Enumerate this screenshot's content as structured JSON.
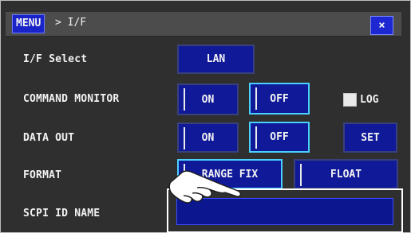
{
  "titlebar": {
    "menu_label": "MENU",
    "breadcrumb": "> I/F",
    "close_label": "×"
  },
  "rows": {
    "if_select": {
      "label": "I/F Select",
      "value": "LAN"
    },
    "command_monitor": {
      "label": "COMMAND MONITOR",
      "on_label": "ON",
      "off_label": "OFF",
      "selected": "OFF",
      "log_label": "LOG",
      "log_checked": false
    },
    "data_out": {
      "label": "DATA OUT",
      "on_label": "ON",
      "off_label": "OFF",
      "selected": "OFF",
      "set_label": "SET"
    },
    "format": {
      "label": "FORMAT",
      "range_fix_label": "RANGE FIX",
      "float_label": "FLOAT",
      "selected": "RANGE FIX"
    },
    "scpi_id_name": {
      "label": "SCPI ID NAME",
      "value": ""
    }
  },
  "colors": {
    "background": "#2f2f2f",
    "button_fill": "#101a99",
    "active_border": "#4ad0ff",
    "menu_blue": "#1a23c8"
  },
  "icons": {
    "pointer": "hand-pointer-icon"
  }
}
